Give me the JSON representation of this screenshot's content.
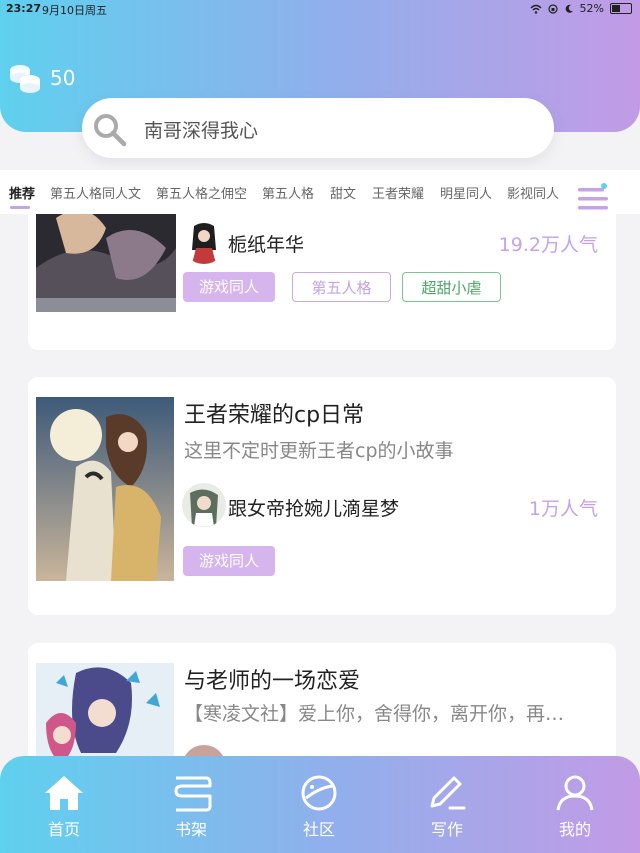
{
  "status": {
    "time": "23:27",
    "date": "9月10日周五",
    "battery": "52%",
    "battery_level": 0.52
  },
  "header": {
    "coins": "50"
  },
  "search": {
    "text": "南哥深得我心"
  },
  "tabs": [
    "推荐",
    "第五人格同人文",
    "第五人格之佣空",
    "第五人格",
    "甜文",
    "王者荣耀",
    "明星同人",
    "影视同人"
  ],
  "cards": [
    {
      "author": "栀纸年华",
      "popularity": "19.2万人气",
      "tags": [
        "游戏同人",
        "第五人格",
        "超甜小虐"
      ]
    },
    {
      "title": "王者荣耀的cp日常",
      "description": "这里不定时更新王者cp的小故事",
      "author": "跟女帝抢婉儿滴星梦",
      "popularity": "1万人气",
      "tags": [
        "游戏同人"
      ]
    },
    {
      "title": "与老师的一场恋爱",
      "description": "【寒凌文社】爱上你，舍得你，离开你，再…"
    }
  ],
  "nav": [
    "首页",
    "书架",
    "社区",
    "写作",
    "我的"
  ],
  "colors": {
    "accent": "#c6a2e8",
    "gradient_start": "#5fd0ee",
    "gradient_end": "#c29be6"
  }
}
